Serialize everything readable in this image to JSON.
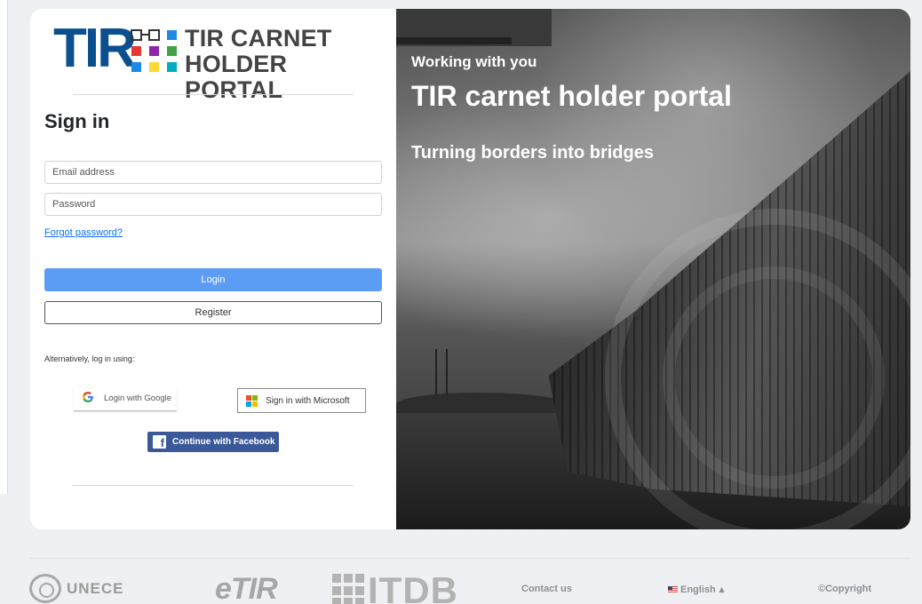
{
  "brand": {
    "logo_letters": "TIR",
    "logo_line1": "TIR CARNET",
    "logo_line2": "HOLDER PORTAL"
  },
  "signin": {
    "title": "Sign in",
    "email_placeholder": "Email address",
    "password_placeholder": "Password",
    "forgot_link": "Forgot password?",
    "login_button": "Login",
    "register_button": "Register",
    "alt_text": "Alternatively, log in using:",
    "google_button": "Login with Google",
    "microsoft_button": "Sign in with Microsoft",
    "facebook_button": "Continue with Facebook"
  },
  "hero": {
    "kicker": "Working with you",
    "title": "TIR carnet holder portal",
    "tagline": "Turning borders into bridges"
  },
  "footer": {
    "unece": "UNECE",
    "etir": "eTIR",
    "itdb": "ITDB",
    "contact": "Contact us",
    "language": "English",
    "language_caret": "▴",
    "copyright": "©Copyright"
  },
  "colors": {
    "primary": "#5b9cf5",
    "facebook": "#3b5998",
    "tir_blue": "#0b4f8f"
  }
}
